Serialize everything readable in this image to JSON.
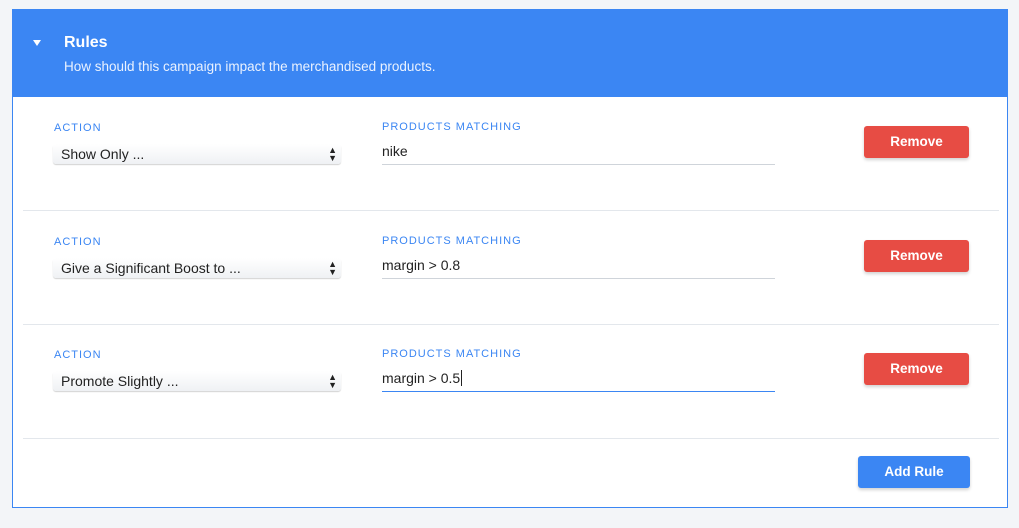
{
  "panel": {
    "title": "Rules",
    "subtitle": "How should this campaign impact the merchandised products."
  },
  "icons": {
    "collapse": "caret-down-icon",
    "select": "up-down-arrows-icon"
  },
  "rules": [
    {
      "action_label": "ACTION",
      "action_value": "Show Only ...",
      "products_label": "PRODUCTS MATCHING",
      "products_value": "nike",
      "remove_label": "Remove"
    },
    {
      "action_label": "ACTION",
      "action_value": "Give a Significant Boost to ...",
      "products_label": "PRODUCTS MATCHING",
      "products_value": "margin > 0.8",
      "remove_label": "Remove"
    },
    {
      "action_label": "ACTION",
      "action_value": "Promote Slightly ...",
      "products_label": "PRODUCTS MATCHING",
      "products_value": "margin > 0.5",
      "remove_label": "Remove"
    }
  ],
  "footer": {
    "add_rule_label": "Add Rule"
  },
  "colors": {
    "accent": "#3b86f3",
    "danger": "#e74c44"
  }
}
